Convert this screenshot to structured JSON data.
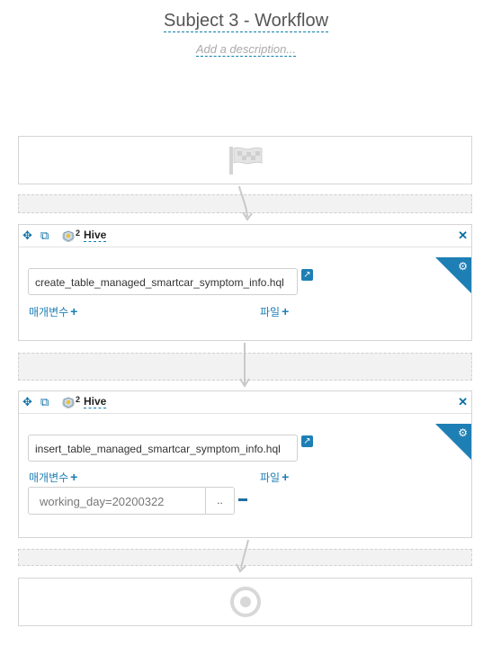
{
  "workflow": {
    "title": "Subject 3 - Workflow",
    "description_placeholder": "Add a description..."
  },
  "actions": [
    {
      "badge": "2",
      "type": "Hive",
      "script": "create_table_managed_smartcar_symptom_info.hql",
      "params_label": "매개변수",
      "files_label": "파일",
      "params": []
    },
    {
      "badge": "2",
      "type": "Hive",
      "script": "insert_table_managed_smartcar_symptom_info.hql",
      "params_label": "매개변수",
      "files_label": "파일",
      "params": [
        {
          "value": "working_day=20200322",
          "button": ".."
        }
      ]
    }
  ],
  "icons": {
    "start": "flag-icon",
    "end": "target-icon",
    "move": "move-icon",
    "copy": "copy-icon",
    "hive": "hive-icon",
    "close": "close-icon",
    "settings": "gears-icon",
    "external": "external-link-icon"
  },
  "colors": {
    "accent": "#1e7fb5",
    "border": "#d5d5d5",
    "dropzone": "#f2f2f2"
  }
}
